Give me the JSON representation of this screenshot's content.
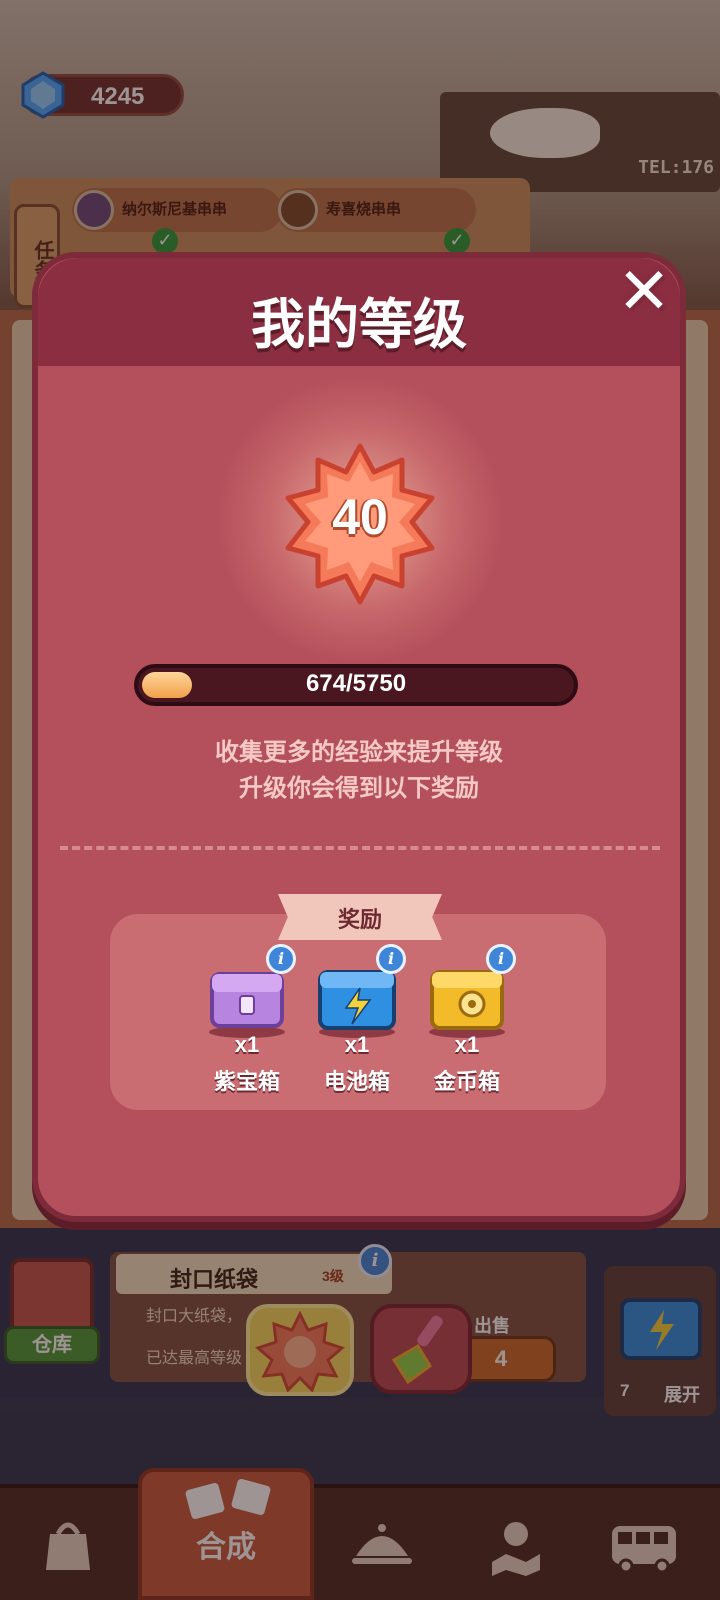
{
  "hud": {
    "gems": "4245",
    "shop_tel": "TEL:176"
  },
  "orders": {
    "task_tab": "任务",
    "items": [
      {
        "name": "纳尔斯尼基串串",
        "done": true
      },
      {
        "name": "寿喜烧串串",
        "done": true
      }
    ]
  },
  "modal": {
    "title": "我的等级",
    "close_symbol": "✕",
    "level": "40",
    "xp_current": 674,
    "xp_max": 5750,
    "xp_text": "674/5750",
    "hint_line1": "收集更多的经验来提升等级",
    "hint_line2": "升级你会得到以下奖励",
    "rewards_title": "奖励",
    "rewards": [
      {
        "name": "紫宝箱",
        "qty": "x1",
        "color": "#b784e0",
        "icon": "purple-chest-icon"
      },
      {
        "name": "电池箱",
        "qty": "x1",
        "color": "#2f8fe0",
        "icon": "battery-chest-icon"
      },
      {
        "name": "金币箱",
        "qty": "x1",
        "color": "#f3bb2a",
        "icon": "gold-chest-icon"
      }
    ],
    "info_symbol": "i"
  },
  "item_info": {
    "warehouse_label": "仓库",
    "title": "封口纸袋",
    "level": "3级",
    "desc_line1": "封口大纸袋，",
    "desc_line2": "已达最高等级",
    "sell_label": "出售",
    "sell_price": "4",
    "expand_count": "7",
    "expand_label": "展开"
  },
  "nav": {
    "active_label": "合成",
    "items": [
      "bag-icon",
      "merge-icon",
      "cloche-icon",
      "map-icon",
      "bus-icon"
    ]
  },
  "colors": {
    "modal_bg": "#b4505c",
    "header_bg": "#8c2e41",
    "xp_fill": "#f0a14a",
    "badge": "#f47a5a"
  }
}
